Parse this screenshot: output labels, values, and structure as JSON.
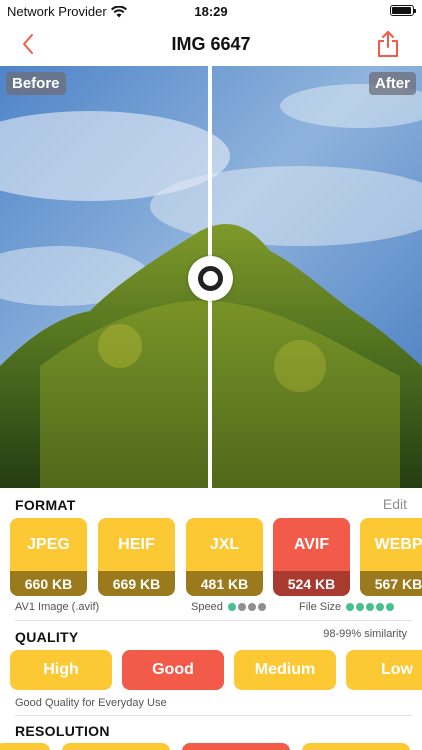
{
  "status_bar": {
    "carrier": "Network Provider",
    "time": "18:29",
    "icons": [
      "wifi-icon",
      "battery-icon"
    ]
  },
  "nav": {
    "title": "IMG 6647",
    "back_icon": "chevron-left-icon",
    "share_icon": "share-icon"
  },
  "compare": {
    "before_label": "Before",
    "after_label": "After"
  },
  "format": {
    "heading": "FORMAT",
    "edit_label": "Edit",
    "options": [
      {
        "name": "JPEG",
        "size": "660 KB",
        "selected": false
      },
      {
        "name": "HEIF",
        "size": "669 KB",
        "selected": false
      },
      {
        "name": "JXL",
        "size": "481 KB",
        "selected": false
      },
      {
        "name": "AVIF",
        "size": "524 KB",
        "selected": true
      },
      {
        "name": "WEBP",
        "size": "567 KB",
        "selected": false
      }
    ],
    "description": "AV1 Image (.avif)",
    "speed_label": "Speed",
    "speed_rating": 1,
    "speed_max": 4,
    "file_size_label": "File Size",
    "file_size_rating": 5,
    "file_size_max": 5
  },
  "quality": {
    "heading": "QUALITY",
    "similarity": "98-99% similarity",
    "options": [
      {
        "label": "High",
        "selected": false
      },
      {
        "label": "Good",
        "selected": true
      },
      {
        "label": "Medium",
        "selected": false
      },
      {
        "label": "Low",
        "selected": false
      }
    ],
    "description": "Good Quality for Everyday Use"
  },
  "resolution": {
    "heading": "RESOLUTION"
  },
  "colors": {
    "accent": "#f25a4a",
    "yellow": "#fcc834",
    "yellow_dark": "#9a7a1c",
    "red_dark": "#a83a2f",
    "green_dot": "#46c08c",
    "gray_dot": "#8e8e93"
  }
}
